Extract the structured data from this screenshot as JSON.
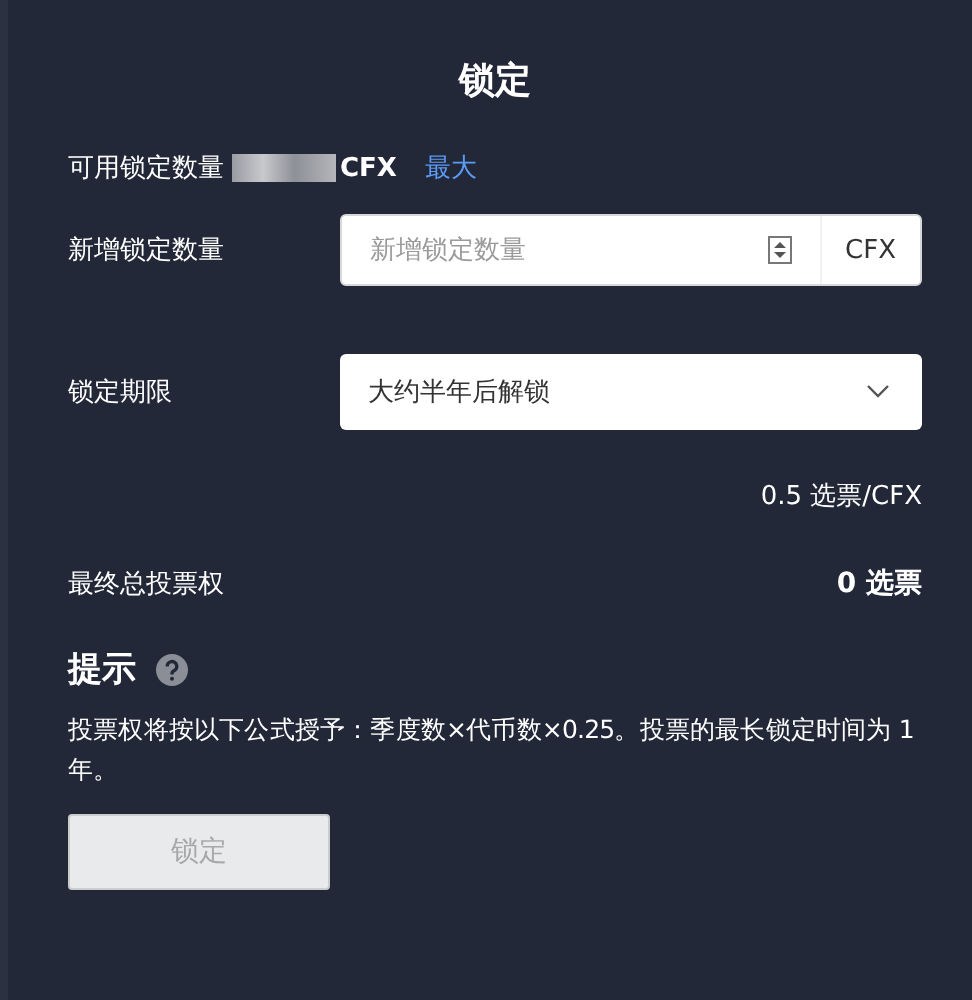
{
  "title": "锁定",
  "available": {
    "label": "可用锁定数量",
    "unit": "CFX",
    "max_link": "最大"
  },
  "amount_field": {
    "label": "新增锁定数量",
    "placeholder": "新增锁定数量",
    "unit": "CFX"
  },
  "period_select": {
    "label": "锁定期限",
    "value": "大约半年后解锁"
  },
  "rate": "0.5 选票/CFX",
  "total": {
    "label": "最终总投票权",
    "value": "0 选票"
  },
  "tip": {
    "title": "提示",
    "text": "投票权将按以下公式授予：季度数×代币数×0.25。投票的最长锁定时间为 1 年。"
  },
  "submit": {
    "label": "锁定",
    "disabled": true
  }
}
